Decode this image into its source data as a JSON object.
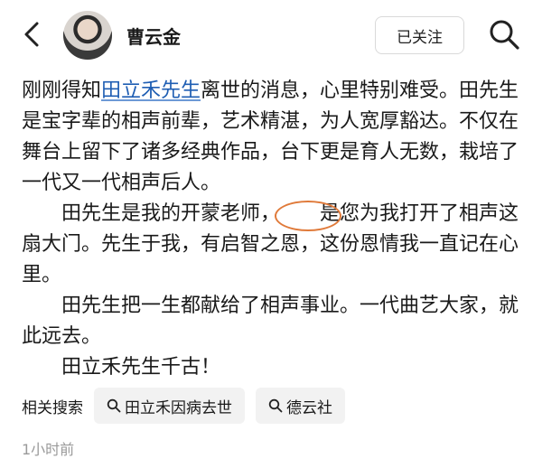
{
  "header": {
    "username": "曹云金",
    "follow_label": "已关注",
    "icons": [
      "back-chevron-icon",
      "search-icon"
    ]
  },
  "post": {
    "p1_prefix": "刚刚得知",
    "p1_link": "田立禾先生",
    "p1_rest": "离世的消息，心里特别难受。田先生是宝字辈的相声前辈，艺术精湛，为人宽厚豁达。不仅在舞台上留下了诸多经典作品，台下更是育人无数，栽培了一代又一代相声后人。",
    "p2_before": "田先生是我的开蒙老师，",
    "p2_circled": "是您为",
    "p2_after": "我打开了相声这扇大门。先生于我，有启智之恩，这份恩情我一直记在心里。",
    "p3": "田先生把一生都献给了相声事业。一代曲艺大家，就此远去。",
    "p4": "田立禾先生千古！"
  },
  "related": {
    "label": "相关搜索",
    "chips": [
      "田立禾因病去世",
      "德云社"
    ]
  },
  "meta": {
    "time": "1小时前"
  },
  "colors": {
    "link": "#1f5eb3",
    "circle_mark": "#e07a3a",
    "chip_bg": "#f2f2f2",
    "muted_text": "#9a9a9a"
  }
}
